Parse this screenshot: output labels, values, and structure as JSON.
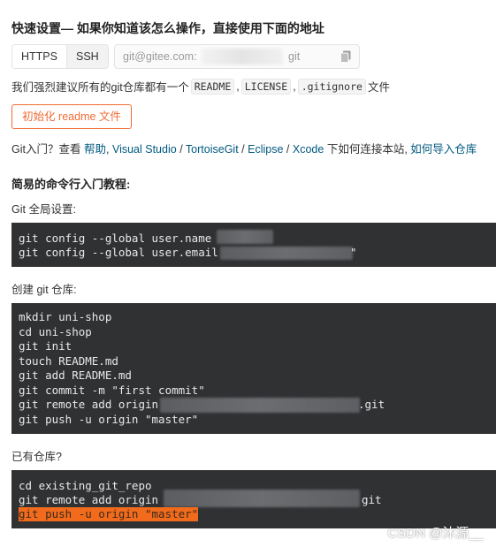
{
  "title": "快速设置— 如果你知道该怎么操作，直接使用下面的地址",
  "protocol": {
    "https_label": "HTTPS",
    "ssh_label": "SSH"
  },
  "url": {
    "prefix": "git@gitee.com:",
    "suffix": "git"
  },
  "recommend": {
    "text_before": "我们强烈建议所有的git仓库都有一个",
    "readme": "README",
    "comma1": ",",
    "license": "LICENSE",
    "comma2": ",",
    "gitignore": ".gitignore",
    "text_after": "文件"
  },
  "init_button": "初始化 readme 文件",
  "guide": {
    "intro": "Git入门？查看",
    "help": "帮助",
    "sep1": ",",
    "visual_studio": "Visual Studio",
    "slash1": "/",
    "tortoisegit": "TortoiseGit",
    "slash2": "/",
    "eclipse": "Eclipse",
    "slash3": "/",
    "xcode": "Xcode",
    "middle": "下如何连接本站,",
    "import_link": "如何导入仓库"
  },
  "tutorial_heading": "简易的命令行入门教程:",
  "global_setup": {
    "label": "Git 全局设置:",
    "lines": [
      "git config --global user.name \"",
      "git config --global user.email "
    ],
    "email_tail": "\""
  },
  "create_repo": {
    "label": "创建 git 仓库:",
    "lines": [
      "mkdir uni-shop",
      "cd uni-shop",
      "git init",
      "touch README.md",
      "git add README.md",
      "git commit -m \"first commit\"",
      "git remote add origin ",
      "git push -u origin \"master\""
    ],
    "remote_tail": ".git"
  },
  "existing_repo": {
    "label": "已有仓库?",
    "lines": [
      "cd existing_git_repo",
      "git remote add origin ",
      "git push -u origin \"master\""
    ],
    "remote_tail": "git"
  },
  "watermark": "CSDN @沐源__",
  "colors": {
    "accent": "#f26b35",
    "link": "#005980",
    "code_bg": "#2f3133",
    "highlight": "#f26b1d"
  }
}
